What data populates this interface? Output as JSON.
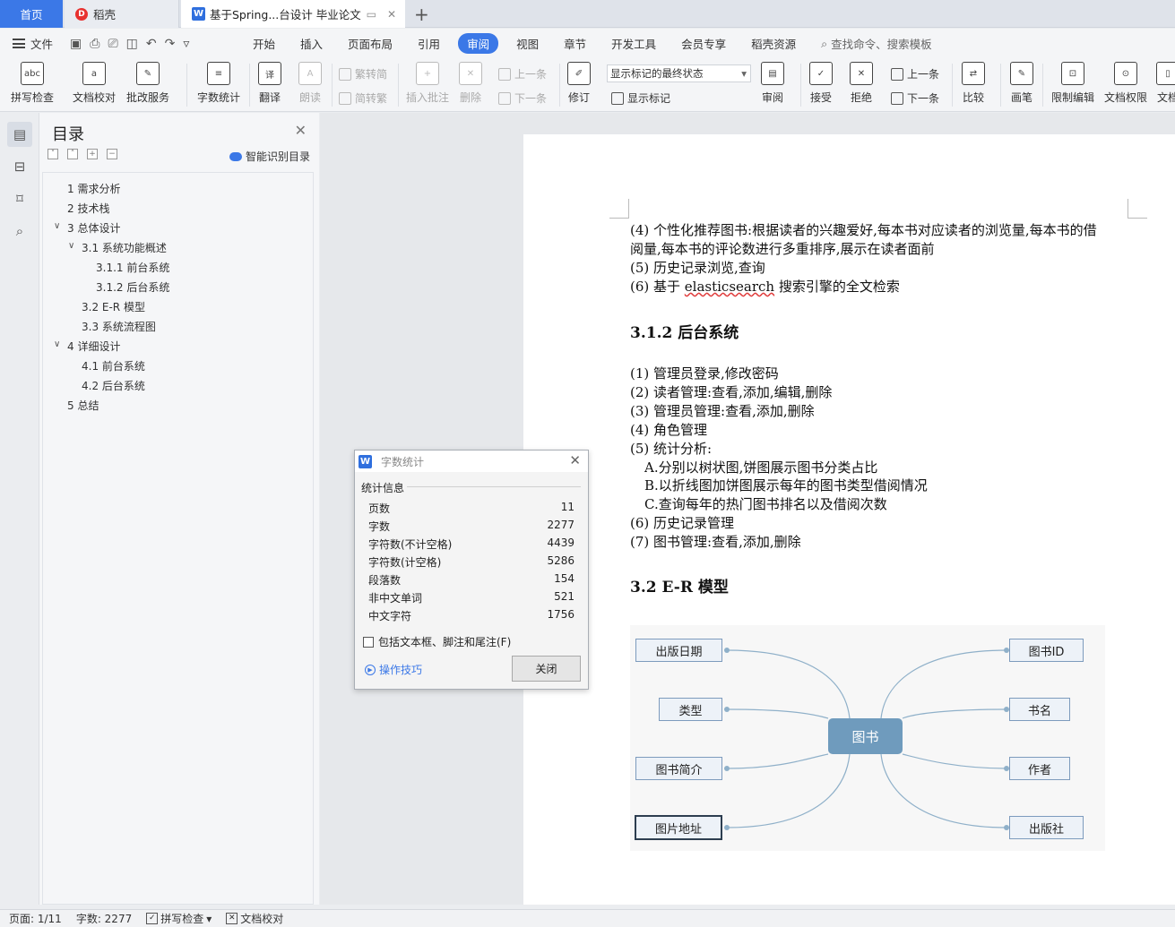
{
  "tabs": {
    "home": "首页",
    "docer": "稻壳",
    "doc": "基于Spring...台设计 毕业论文"
  },
  "menu": {
    "file": "文件",
    "items": [
      "开始",
      "插入",
      "页面布局",
      "引用",
      "审阅",
      "视图",
      "章节",
      "开发工具",
      "会员专享",
      "稻壳资源"
    ],
    "active": "审阅",
    "search": "查找命令、搜索模板"
  },
  "ribbon": {
    "spell": "拼写检查",
    "proof": "文档校对",
    "correct": "批改服务",
    "wordcount": "字数统计",
    "translate": "翻译",
    "read": "朗读",
    "trad": "繁转简",
    "simp": "简转繁",
    "insert_comment": "插入批注",
    "delete": "删除",
    "prev": "上一条",
    "next": "下一条",
    "track": "修订",
    "markup_state": "显示标记的最终状态",
    "show_markup": "显示标记",
    "review": "审阅",
    "accept": "接受",
    "reject": "拒绝",
    "prev2": "上一条",
    "next2": "下一条",
    "compare": "比较",
    "pen": "画笔",
    "restrict": "限制编辑",
    "rights": "文档权限",
    "more": "文档"
  },
  "toc": {
    "title": "目录",
    "ai": "智能识别目录",
    "items": [
      "1  需求分析",
      "2 技术栈",
      "3  总体设计",
      "3.1  系统功能概述",
      "3.1.1  前台系统",
      "3.1.2  后台系统",
      "3.2 E-R 模型",
      "3.3  系统流程图",
      "4  详细设计",
      "4.1  前台系统",
      "4.2  后台系统",
      "5  总结"
    ]
  },
  "document": {
    "lines": [
      "(4)  个性化推荐图书:根据读者的兴趣爱好,每本书对应读者的浏览量,每本书的借",
      "阅量,每本书的评论数进行多重排序,展示在读者面前",
      "(5)  历史记录浏览,查询",
      "(6)  基于 "
    ],
    "elastic_word": "elasticsearch",
    "line6_tail": " 搜索引擎的全文检索",
    "heading_312": "3.1.2  后台系统",
    "admin_lines": [
      "(1)  管理员登录,修改密码",
      "(2)  读者管理:查看,添加,编辑,删除",
      "(3)  管理员管理:查看,添加,删除",
      "(4)  角色管理",
      "(5)  统计分析:",
      "A.分别以树状图,饼图展示图书分类占比",
      "B.以折线图加饼图展示每年的图书类型借阅情况",
      "C.查询每年的热门图书排名以及借阅次数",
      "(6)  历史记录管理",
      "(7)  图书管理:查看,添加,删除"
    ],
    "heading_32": "3.2 E-R 模型"
  },
  "mindmap": {
    "center": "图书",
    "left": [
      "出版日期",
      "类型",
      "图书简介",
      "图片地址"
    ],
    "right": [
      "图书ID",
      "书名",
      "作者",
      "出版社"
    ]
  },
  "dialog": {
    "title": "字数统计",
    "section": "统计信息",
    "stats": [
      {
        "label": "页数",
        "value": "11"
      },
      {
        "label": "字数",
        "value": "2277"
      },
      {
        "label": "字符数(不计空格)",
        "value": "4439"
      },
      {
        "label": "字符数(计空格)",
        "value": "5286"
      },
      {
        "label": "段落数",
        "value": "154"
      },
      {
        "label": "非中文单词",
        "value": "521"
      },
      {
        "label": "中文字符",
        "value": "1756"
      }
    ],
    "include": "包括文本框、脚注和尾注(F)",
    "tips": "操作技巧",
    "close": "关闭"
  },
  "status": {
    "page": "页面: 1/11",
    "words": "字数: 2277",
    "spell": "拼写检查",
    "proof": "文档校对"
  },
  "colors": {
    "accent": "#3b78e7",
    "center_node": "#6f9bbd"
  }
}
